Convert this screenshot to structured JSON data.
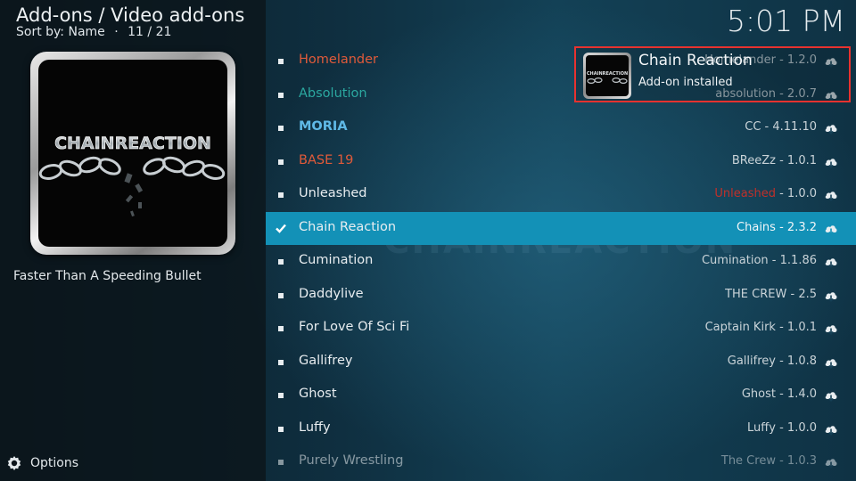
{
  "header": {
    "title": "Add-ons / Video add-ons",
    "sort_label": "Sort by: Name",
    "separator": "·",
    "position": "11 / 21"
  },
  "clock": "5:01 PM",
  "thumbnail": {
    "logo_text": "CHAINREACTION",
    "icon": "chain-reaction-logo"
  },
  "description": "Faster Than A Speeding Bullet",
  "options": {
    "label": "Options",
    "icon": "gear-icon"
  },
  "notification": {
    "title": "Chain Reaction",
    "message": "Add-on installed",
    "icon": "chain-reaction-logo"
  },
  "colors": {
    "selected_bg": "#1391b7",
    "red": "#e05a3a",
    "teal": "#2ba8a0",
    "blue": "#5fb9e6",
    "toast_border": "#e8322f"
  },
  "addons": [
    {
      "name": "Homelander",
      "author": "Homelander",
      "version": "1.2.0",
      "name_color": "#e05a3a"
    },
    {
      "name": "Absolution",
      "author": "absolution",
      "version": "2.0.7",
      "name_color": "#2ba8a0"
    },
    {
      "name": "MORIA",
      "author": "CC",
      "version": "4.11.10",
      "name_color": "#5fb9e6",
      "bold": true
    },
    {
      "name": "BASE 19",
      "author": "BReeZz",
      "version": "1.0.1",
      "name_color": "#e05a3a"
    },
    {
      "name": "Unleashed",
      "author": "Unleashed",
      "version": "1.0.0",
      "author_color": "#c0302a"
    },
    {
      "name": "Chain Reaction",
      "author": "Chains",
      "version": "2.3.2",
      "selected": true
    },
    {
      "name": "Cumination",
      "author": "Cumination",
      "version": "1.1.86"
    },
    {
      "name": "Daddylive",
      "author": "THE CREW",
      "version": "2.5"
    },
    {
      "name": "For Love Of Sci Fi",
      "author": "Captain Kirk",
      "version": "1.0.1"
    },
    {
      "name": "Gallifrey",
      "author": "Gallifrey",
      "version": "1.0.8"
    },
    {
      "name": "Ghost",
      "author": "Ghost",
      "version": "1.4.0"
    },
    {
      "name": "Luffy",
      "author": "Luffy",
      "version": "1.0.0"
    },
    {
      "name": "Purely Wrestling",
      "author": "The Crew",
      "version": "1.0.3",
      "faded": true
    }
  ]
}
